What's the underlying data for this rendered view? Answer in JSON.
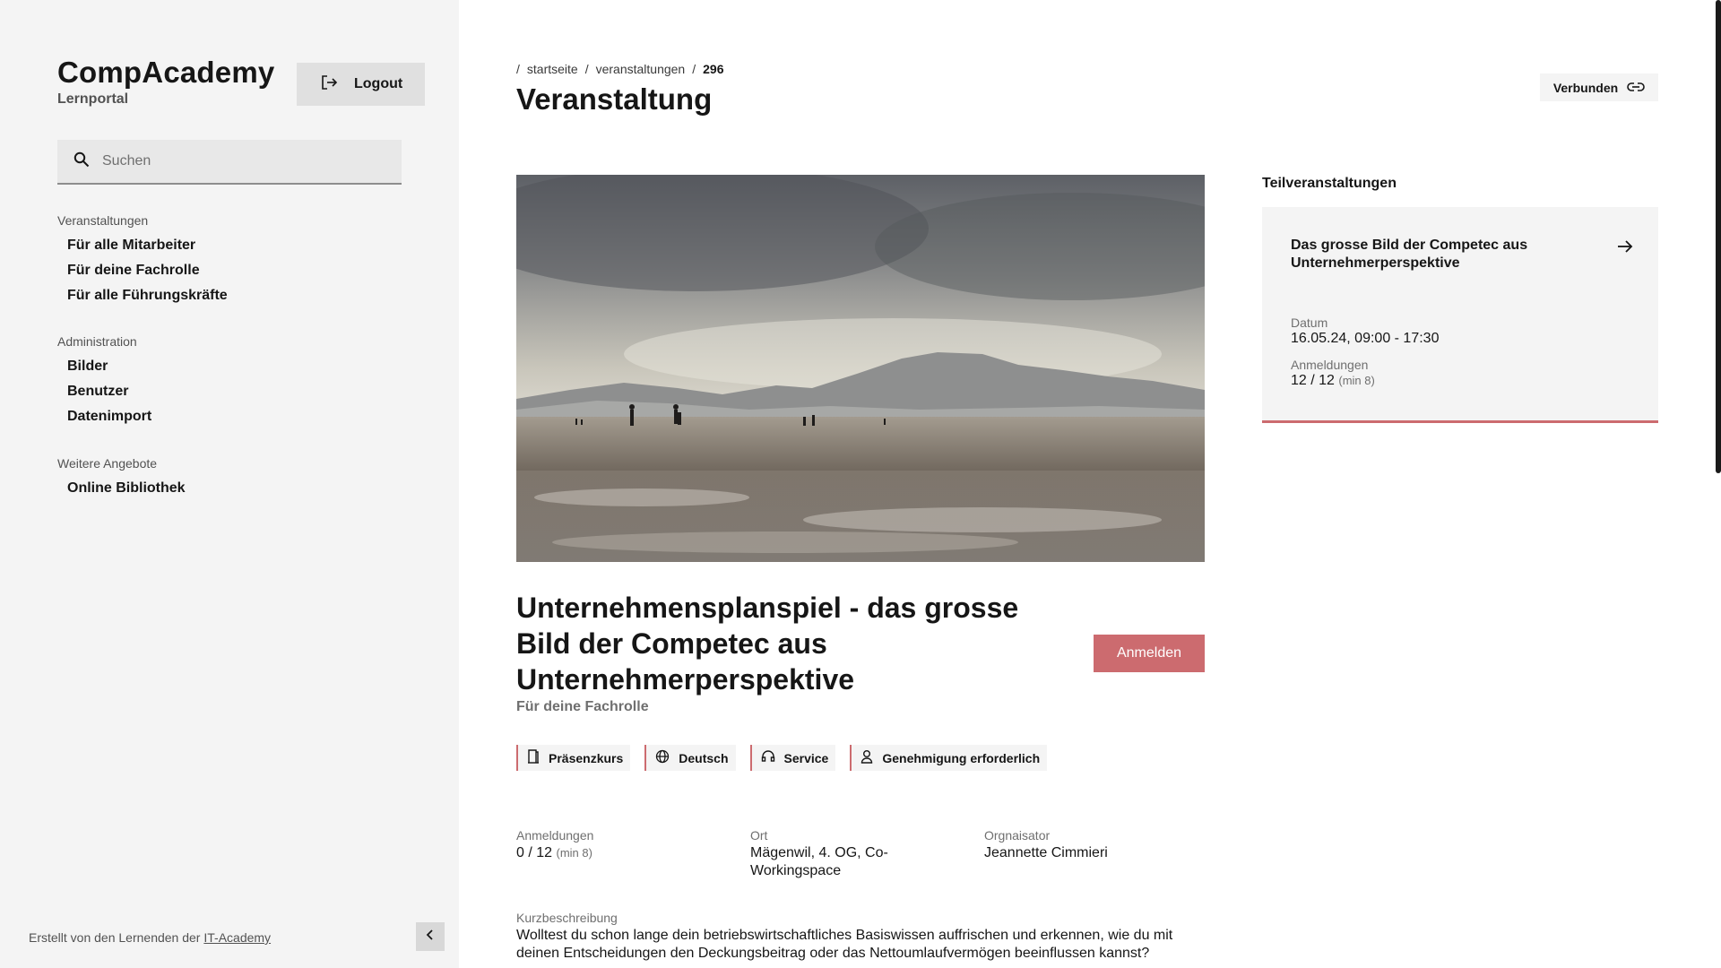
{
  "brand": {
    "title": "CompAcademy",
    "subtitle": "Lernportal"
  },
  "logout": {
    "label": "Logout",
    "icon": "logout-icon"
  },
  "search": {
    "placeholder": "Suchen",
    "value": ""
  },
  "nav": [
    {
      "heading": "Veranstaltungen",
      "items": [
        "Für alle Mitarbeiter",
        "Für deine Fachrolle",
        "Für alle Führungskräfte"
      ]
    },
    {
      "heading": "Administration",
      "items": [
        "Bilder",
        "Benutzer",
        "Datenimport"
      ]
    },
    {
      "heading": "Weitere Angebote",
      "items": [
        "Online Bibliothek"
      ]
    }
  ],
  "footer": {
    "text": "Erstellt von den Lernenden der ",
    "link": "IT-Academy"
  },
  "breadcrumb": {
    "items": [
      "startseite",
      "veranstaltungen",
      "296"
    ]
  },
  "page_title": "Veranstaltung",
  "verbunden": {
    "label": "Verbunden",
    "icon": "link-icon"
  },
  "event": {
    "title": "Unternehmensplanspiel - das grosse Bild der Competec aus Unternehmerperspektive",
    "subtitle": "Für deine Fachrolle",
    "register_label": "Anmelden",
    "tags": [
      {
        "label": "Präsenzkurs",
        "icon": "door-icon"
      },
      {
        "label": "Deutsch",
        "icon": "globe-icon"
      },
      {
        "label": "Service",
        "icon": "headset-icon"
      },
      {
        "label": "Genehmigung erforderlich",
        "icon": "user-check-icon"
      }
    ],
    "registrations": {
      "label": "Anmeldungen",
      "value": "0 / 12",
      "min": "(min 8)"
    },
    "location": {
      "label": "Ort",
      "value": "Mägenwil, 4. OG, Co-Workingspace"
    },
    "organizer": {
      "label": "Orgnaisator",
      "value": "Jeannette Cimmieri"
    },
    "description": {
      "label": "Kurzbeschreibung",
      "text": "Wolltest du schon lange dein betriebswirtschaftliches Basiswissen auffrischen und erkennen, wie du mit deinen Entscheidungen den Deckungsbeitrag oder das Nettoumlaufvermögen beeinflussen kannst?"
    }
  },
  "sub_events": {
    "heading": "Teilveranstaltungen",
    "items": [
      {
        "title": "Das grosse Bild der Competec aus Unternehmerperspektive",
        "date_label": "Datum",
        "date": "16.05.24, 09:00 - 17:30",
        "reg_label": "Anmeldungen",
        "reg_value": "12 / 12",
        "reg_min": "(min 8)"
      }
    ]
  },
  "colors": {
    "accent": "#cc6b6f",
    "sidebar_bg": "#f4f4f4",
    "text": "#161616"
  }
}
